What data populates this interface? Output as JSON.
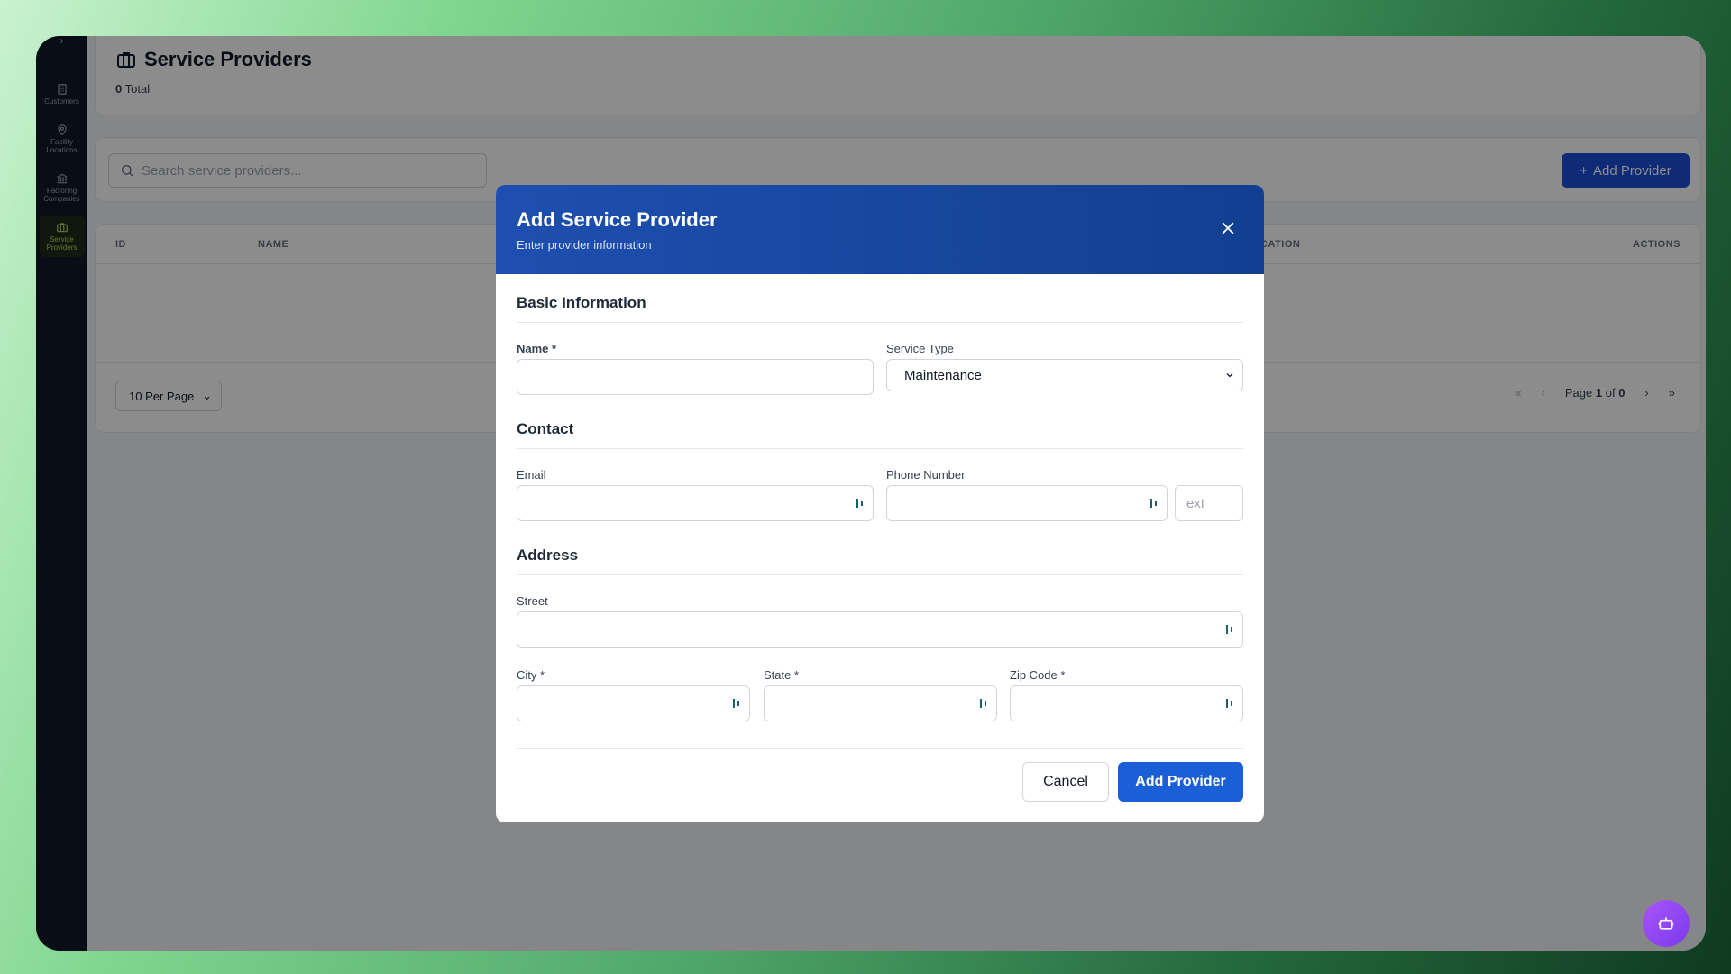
{
  "sidebar": {
    "items": [
      {
        "label": "Customers",
        "icon": "building-icon"
      },
      {
        "label": "Facility Locations",
        "icon": "map-pin-icon"
      },
      {
        "label": "Factoring Companies",
        "icon": "bank-icon"
      },
      {
        "label": "Service Providers",
        "icon": "briefcase-icon",
        "active": true
      }
    ]
  },
  "header": {
    "title": "Service Providers",
    "total_count": "0",
    "total_label": "Total"
  },
  "toolbar": {
    "search_placeholder": "Search service providers...",
    "add_label": "Add Provider"
  },
  "table": {
    "columns": [
      "ID",
      "NAME",
      "CATION",
      "ACTIONS"
    ],
    "per_page": "10 Per Page",
    "pagination": {
      "first": "«",
      "prev": "‹",
      "page_word": "Page",
      "current": "1",
      "of_word": "of",
      "total": "0",
      "next": "›",
      "last": "»"
    }
  },
  "modal": {
    "title": "Add Service Provider",
    "subtitle": "Enter provider information",
    "sections": {
      "basic": "Basic Information",
      "contact": "Contact",
      "address": "Address"
    },
    "fields": {
      "name_label": "Name *",
      "service_type_label": "Service Type",
      "service_type_value": "Maintenance",
      "email_label": "Email",
      "phone_label": "Phone Number",
      "ext_placeholder": "ext",
      "street_label": "Street",
      "city_label": "City *",
      "state_label": "State *",
      "zip_label": "Zip Code *"
    },
    "cancel_label": "Cancel",
    "submit_label": "Add Provider"
  },
  "colors": {
    "primary": "#1d4ed8",
    "modal_header": "#1e4fb0",
    "sidebar": "#111827",
    "active_accent": "#b5d94b",
    "bot": "#a855f7"
  }
}
